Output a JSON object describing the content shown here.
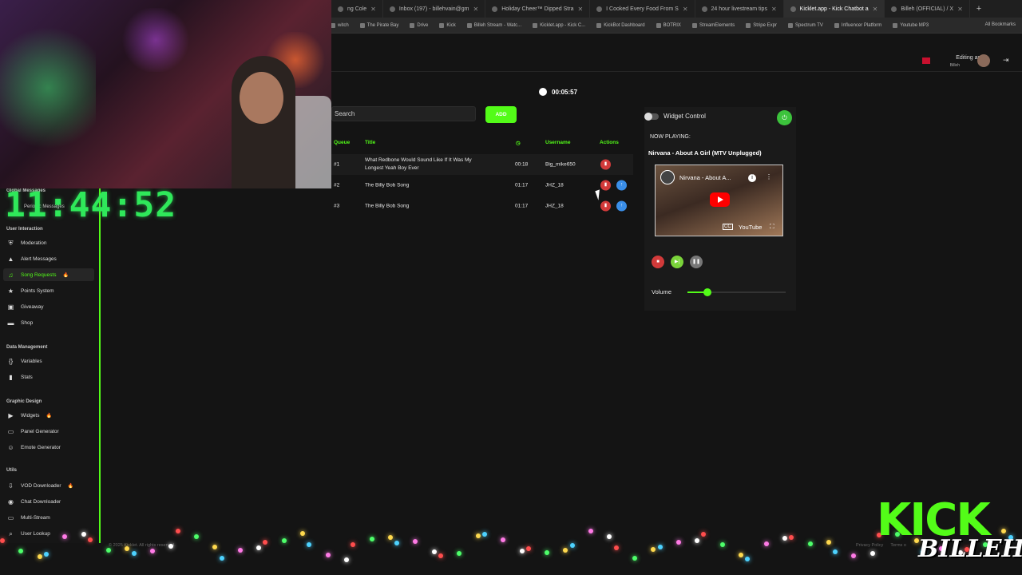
{
  "browser": {
    "tabs": [
      {
        "label": "ng Cole",
        "active": false
      },
      {
        "label": "Inbox (197) - billehvain@gm",
        "active": false
      },
      {
        "label": "Holiday Cheer™ Dipped Stra",
        "active": false
      },
      {
        "label": "I Cooked Every Food From S",
        "active": false
      },
      {
        "label": "24 hour livestream tips",
        "active": false
      },
      {
        "label": "Kicklet.app - Kick Chatbot a",
        "active": true
      },
      {
        "label": "Billeh (OFFICIAL) / X",
        "active": false
      }
    ],
    "bookmarks": [
      "witch",
      "The Pirate Bay",
      "Drive",
      "Kick",
      "Billeh Stream - Watc...",
      "Kicklet.app - Kick C...",
      "KickBot Dashboard",
      "BOTRIX",
      "StreamElements",
      "Stripe Expr",
      "Spectrum TV",
      "Influencer Platform",
      "Youtube MP3"
    ],
    "bookmarks_all": "All Bookmarks"
  },
  "overlay": {
    "clock": "11:44:52",
    "kick_logo": "KICK",
    "billeh_logo": "BILLEH"
  },
  "header": {
    "editing_as": "Editing as",
    "user": "Billeh"
  },
  "sidebar": {
    "partial_items": [
      "Global Messages",
      "Periodic Messages"
    ],
    "groups": [
      {
        "title": "User Interaction",
        "items": [
          {
            "label": "Moderation",
            "icon": "shield-icon",
            "active": false,
            "badge": ""
          },
          {
            "label": "Alert Messages",
            "icon": "alert-icon",
            "active": false,
            "badge": ""
          },
          {
            "label": "Song Requests",
            "icon": "music-icon",
            "active": true,
            "badge": "fire"
          },
          {
            "label": "Points System",
            "icon": "star-icon",
            "active": false,
            "badge": ""
          },
          {
            "label": "Giveaway",
            "icon": "gift-icon",
            "active": false,
            "badge": ""
          },
          {
            "label": "Shop",
            "icon": "cart-icon",
            "active": false,
            "badge": ""
          }
        ]
      },
      {
        "title": "Data Management",
        "items": [
          {
            "label": "Variables",
            "icon": "code-icon",
            "active": false,
            "badge": ""
          },
          {
            "label": "Stats",
            "icon": "chart-icon",
            "active": false,
            "badge": ""
          }
        ]
      },
      {
        "title": "Graphic Design",
        "items": [
          {
            "label": "Widgets",
            "icon": "video-icon",
            "active": false,
            "badge": "fire"
          },
          {
            "label": "Panel Generator",
            "icon": "panel-icon",
            "active": false,
            "badge": ""
          },
          {
            "label": "Emote Generator",
            "icon": "smile-icon",
            "active": false,
            "badge": ""
          }
        ]
      },
      {
        "title": "Utils",
        "items": [
          {
            "label": "VOD Downloader",
            "icon": "download-icon",
            "active": false,
            "badge": "fire"
          },
          {
            "label": "Chat Downloader",
            "icon": "chat-icon",
            "active": false,
            "badge": ""
          },
          {
            "label": "Multi-Stream",
            "icon": "monitor-icon",
            "active": false,
            "badge": ""
          },
          {
            "label": "User Lookup",
            "icon": "search-icon",
            "active": false,
            "badge": ""
          }
        ]
      }
    ]
  },
  "main": {
    "timer": "00:05:57",
    "search_placeholder": "Search",
    "add_label": "ADD",
    "columns": {
      "queue": "Queue",
      "title": "Title",
      "username": "Username",
      "actions": "Actions"
    },
    "queue": [
      {
        "pos": "#1",
        "title_line1": "What Redbone Would Sound Like If It Was My",
        "title_line2": "Longest Yeah Boy Ever",
        "duration": "00:18",
        "username": "Big_mike650",
        "has_up": false
      },
      {
        "pos": "#2",
        "title_line1": "The Billy Bob Song",
        "title_line2": "",
        "duration": "01:17",
        "username": "JHZ_18",
        "has_up": true
      },
      {
        "pos": "#3",
        "title_line1": "The Billy Bob Song",
        "title_line2": "",
        "duration": "01:17",
        "username": "JHZ_18",
        "has_up": true
      }
    ]
  },
  "widget": {
    "control_label": "Widget Control",
    "now_playing_label": "NOW PLAYING:",
    "now_playing_title": "Nirvana - About A Girl (MTV Unplugged)",
    "video_title": "Nirvana - About A...",
    "video_brand": "YouTube",
    "volume_label": "Volume",
    "volume": 0.2
  },
  "footer": {
    "copyright": "© 2025 Kicklet. All rights reserved.",
    "privacy": "Privacy Policy",
    "terms": "Terms o"
  },
  "colors": {
    "accent": "#53fc18",
    "danger": "#d23a3a",
    "info": "#3a8ee8",
    "bg": "#141414"
  }
}
